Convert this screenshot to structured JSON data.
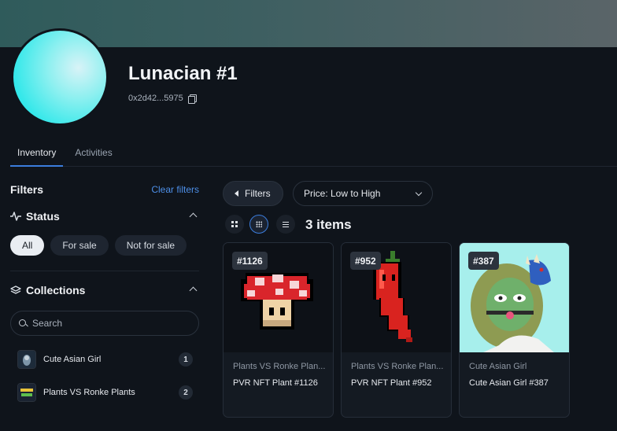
{
  "profile": {
    "name": "Lunacian #1",
    "address": "0x2d42...5975"
  },
  "tabs": [
    {
      "label": "Inventory",
      "active": true
    },
    {
      "label": "Activities",
      "active": false
    }
  ],
  "sidebar": {
    "title": "Filters",
    "clear_label": "Clear filters",
    "status": {
      "title": "Status",
      "options": [
        "All",
        "For sale",
        "Not for sale"
      ],
      "selected": "All"
    },
    "collections": {
      "title": "Collections",
      "search_placeholder": "Search",
      "items": [
        {
          "name": "Cute Asian Girl",
          "count": "1"
        },
        {
          "name": "Plants VS Ronke Plants",
          "count": "2"
        }
      ]
    }
  },
  "toolbar": {
    "filters_label": "Filters",
    "sort_label": "Price: Low to High",
    "items_count": "3 items"
  },
  "cards": [
    {
      "badge": "#1126",
      "collection": "Plants VS Ronke Plan...",
      "title": "PVR NFT Plant #1126"
    },
    {
      "badge": "#952",
      "collection": "Plants VS Ronke Plan...",
      "title": "PVR NFT Plant #952"
    },
    {
      "badge": "#387",
      "collection": "Cute Asian Girl",
      "title": "Cute Asian Girl #387"
    }
  ],
  "colors": {
    "background": "#0f141b",
    "accent": "#3b7ddd",
    "avatar": "#35e8ea"
  }
}
